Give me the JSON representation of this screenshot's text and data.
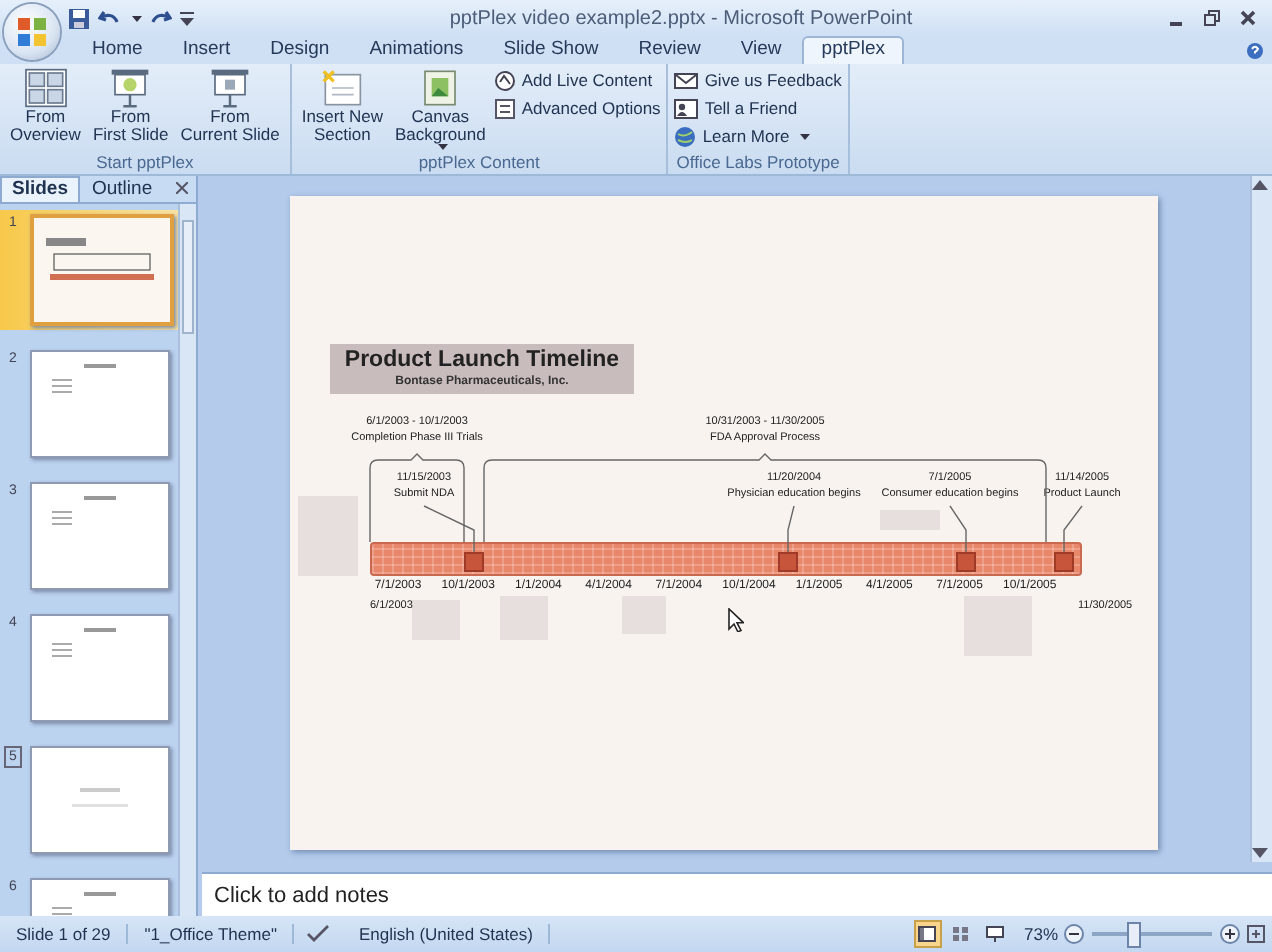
{
  "window": {
    "title": "pptPlex video example2.pptx - Microsoft PowerPoint"
  },
  "ribbon_tabs": [
    {
      "label": "Home",
      "selected": false
    },
    {
      "label": "Insert",
      "selected": false
    },
    {
      "label": "Design",
      "selected": false
    },
    {
      "label": "Animations",
      "selected": false
    },
    {
      "label": "Slide Show",
      "selected": false
    },
    {
      "label": "Review",
      "selected": false
    },
    {
      "label": "View",
      "selected": false
    },
    {
      "label": "pptPlex",
      "selected": true
    }
  ],
  "ribbon_groups": [
    {
      "label": "Start pptPlex",
      "buttons": [
        {
          "kind": "large",
          "lines": [
            "From",
            "Overview"
          ],
          "has_menu": false
        },
        {
          "kind": "large",
          "lines": [
            "From",
            "First Slide"
          ],
          "has_menu": false
        },
        {
          "kind": "large",
          "lines": [
            "From",
            "Current Slide"
          ],
          "has_menu": false
        }
      ]
    },
    {
      "label": "pptPlex Content",
      "buttons": [
        {
          "kind": "large",
          "lines": [
            "Insert New",
            "Section"
          ],
          "has_menu": false
        },
        {
          "kind": "large",
          "lines": [
            "Canvas",
            "Background"
          ],
          "has_menu": true
        },
        {
          "kind": "small",
          "lines": [
            "Add Live Content"
          ],
          "has_menu": false
        },
        {
          "kind": "small",
          "lines": [
            "Advanced Options"
          ],
          "has_menu": false
        }
      ]
    },
    {
      "label": "Office Labs Prototype",
      "buttons": [
        {
          "kind": "small",
          "lines": [
            "Give us Feedback"
          ],
          "has_menu": false
        },
        {
          "kind": "small",
          "lines": [
            "Tell a Friend"
          ],
          "has_menu": false
        },
        {
          "kind": "small",
          "lines": [
            "Learn More"
          ],
          "has_menu": true
        }
      ]
    }
  ],
  "panel_tabs": [
    {
      "label": "Slides",
      "selected": true
    },
    {
      "label": "Outline",
      "selected": false
    }
  ],
  "slides": [
    {
      "number": "1",
      "kind": "timeline",
      "selected": true,
      "hidden": false
    },
    {
      "number": "2",
      "kind": "bullets",
      "selected": false,
      "hidden": false
    },
    {
      "number": "3",
      "kind": "bullets",
      "selected": false,
      "hidden": false
    },
    {
      "number": "4",
      "kind": "bullets",
      "selected": false,
      "hidden": false
    },
    {
      "number": "5",
      "kind": "section",
      "selected": false,
      "hidden": true
    },
    {
      "number": "6",
      "kind": "bullets",
      "selected": false,
      "hidden": false
    }
  ],
  "slide": {
    "title": "Product Launch Timeline",
    "subtitle": "Bontase Pharmaceuticals, Inc.",
    "start_date": "6/1/2003",
    "end_date": "11/30/2005",
    "ticks": [
      "7/1/2003",
      "10/1/2003",
      "1/1/2004",
      "4/1/2004",
      "7/1/2004",
      "10/1/2004",
      "1/1/2005",
      "4/1/2005",
      "7/1/2005",
      "10/1/2005"
    ],
    "spans": [
      {
        "dates": "6/1/2003 - 10/1/2003",
        "label": "Completion Phase III Trials"
      },
      {
        "dates": "10/31/2003 - 11/30/2005",
        "label": "FDA Approval Process"
      }
    ],
    "milestones": [
      {
        "date": "11/15/2003",
        "label": "Submit NDA"
      },
      {
        "date": "11/20/2004",
        "label": "Physician education begins"
      },
      {
        "date": "7/1/2005",
        "label": "Consumer education begins"
      },
      {
        "date": "11/14/2005",
        "label": "Product Launch"
      }
    ]
  },
  "notes": {
    "placeholder": "Click to add notes"
  },
  "status_bar": {
    "slide": "Slide 1 of 29",
    "theme": "\"1_Office Theme\"",
    "language": "English (United States)",
    "views": [
      {
        "selected": true
      },
      {
        "selected": false
      },
      {
        "selected": false
      }
    ],
    "zoom": "73%",
    "zoom_slider": {
      "level": 0.35
    }
  }
}
